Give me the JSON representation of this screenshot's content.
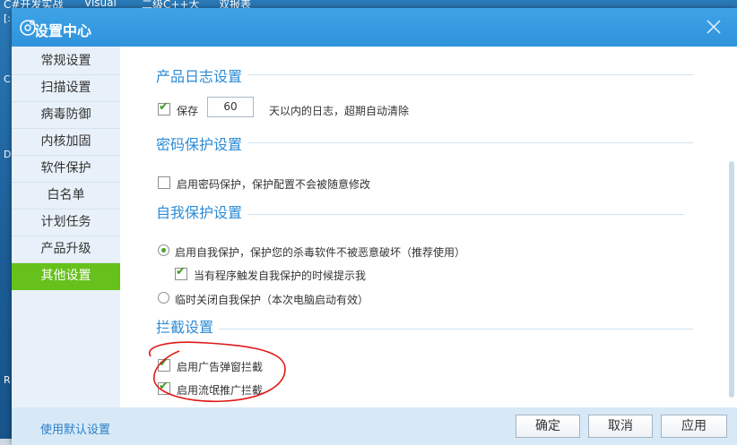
{
  "desktop": {
    "tabs": [
      "C#开发实战",
      "Visual",
      "二级C++大",
      "双报表"
    ],
    "letters": [
      "[:",
      "C",
      "D",
      "R"
    ]
  },
  "dialog": {
    "title": "设置中心",
    "sidebar": {
      "items": [
        {
          "label": "常规设置"
        },
        {
          "label": "扫描设置"
        },
        {
          "label": "病毒防御"
        },
        {
          "label": "内核加固"
        },
        {
          "label": "软件保护"
        },
        {
          "label": "白名单"
        },
        {
          "label": "计划任务"
        },
        {
          "label": "产品升级"
        },
        {
          "label": "其他设置"
        }
      ],
      "active_index": 8
    },
    "log_section": {
      "title": "产品日志设置",
      "keep_label": "保存",
      "days_value": "60",
      "days_suffix": "天以内的日志，超期自动清除",
      "keep_checked": true
    },
    "password_section": {
      "title": "密码保护设置",
      "enable_label": "启用密码保护，保护配置不会被随意修改",
      "enable_checked": false
    },
    "self_protect_section": {
      "title": "自我保护设置",
      "enable_label": "启用自我保护，保护您的杀毒软件不被恶意破坏（推荐使用）",
      "notify_label": "当有程序触发自我保护的时候提示我",
      "temp_off_label": "临时关闭自我保护（本次电脑启动有效）",
      "selected": "enable",
      "notify_checked": true
    },
    "intercept_section": {
      "title": "拦截设置",
      "popup_label": "启用广告弹窗拦截",
      "rogue_label": "启用流氓推广拦截",
      "popup_checked": true,
      "rogue_checked": true
    },
    "footer": {
      "default_link": "使用默认设置",
      "ok_label": "确定",
      "cancel_label": "取消",
      "apply_label": "应用"
    }
  },
  "colors": {
    "titlebar": "#2f93dc",
    "accent_green": "#66c11c",
    "section_blue": "#2c8bd6",
    "annotation_red": "#e01818"
  }
}
